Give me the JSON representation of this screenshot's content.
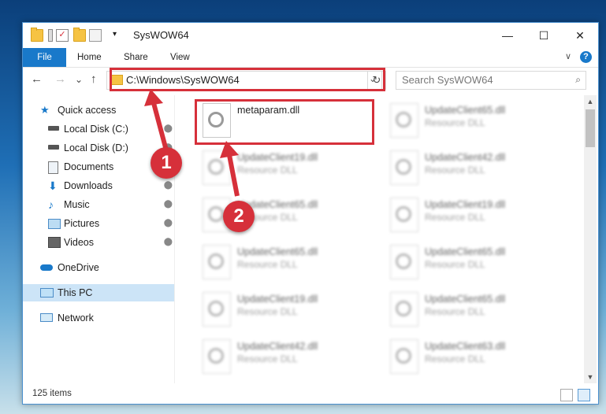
{
  "window": {
    "title": "SysWOW64",
    "minimize": "—",
    "maximize": "☐",
    "close": "✕"
  },
  "ribbon": {
    "tabs": [
      "File",
      "Home",
      "Share",
      "View"
    ],
    "help": "?",
    "collapse": "∨"
  },
  "nav": {
    "back": "←",
    "forward": "→",
    "recent": "⌄",
    "up": "↑",
    "address": "C:\\Windows\\SysWOW64",
    "address_dropdown": "⌄",
    "refresh": "↻",
    "search_placeholder": "Search SysWOW64",
    "search_icon": "⌕"
  },
  "sidebar": {
    "items": [
      {
        "label": "Quick access",
        "icon": "star-icon",
        "pinned": false
      },
      {
        "label": "Local Disk (C:)",
        "icon": "drive-icon",
        "pinned": true
      },
      {
        "label": "Local Disk (D:)",
        "icon": "drive-icon",
        "pinned": true
      },
      {
        "label": "Documents",
        "icon": "documents-icon",
        "pinned": true
      },
      {
        "label": "Downloads",
        "icon": "downloads-icon",
        "pinned": true
      },
      {
        "label": "Music",
        "icon": "music-icon",
        "pinned": true
      },
      {
        "label": "Pictures",
        "icon": "pictures-icon",
        "pinned": true
      },
      {
        "label": "Videos",
        "icon": "videos-icon",
        "pinned": true
      },
      {
        "label": "OneDrive",
        "icon": "cloud-icon",
        "pinned": false
      },
      {
        "label": "This PC",
        "icon": "computer-icon",
        "pinned": false
      },
      {
        "label": "Network",
        "icon": "network-icon",
        "pinned": false
      }
    ],
    "pin_glyph": "📌"
  },
  "files": {
    "highlighted": {
      "name": "metaparam.dll"
    },
    "left_column": [
      {
        "name": "UpdateClient19.dll",
        "type": "Resource DLL"
      },
      {
        "name": "UpdateClient65.dll",
        "type": "Resource DLL"
      },
      {
        "name": "UpdateClient65.dll",
        "type": "Resource DLL"
      },
      {
        "name": "UpdateClient19.dll",
        "type": "Resource DLL"
      },
      {
        "name": "UpdateClient42.dll",
        "type": "Resource DLL"
      }
    ],
    "right_column": [
      {
        "name": "UpdateClient65.dll",
        "type": "Resource DLL"
      },
      {
        "name": "UpdateClient42.dll",
        "type": "Resource DLL"
      },
      {
        "name": "UpdateClient19.dll",
        "type": "Resource DLL"
      },
      {
        "name": "UpdateClient65.dll",
        "type": "Resource DLL"
      },
      {
        "name": "UpdateClient65.dll",
        "type": "Resource DLL"
      },
      {
        "name": "UpdateClient63.dll",
        "type": "Resource DLL"
      }
    ]
  },
  "annotations": {
    "badge1": "1",
    "badge2": "2",
    "highlight_color": "#d6303a"
  },
  "status": {
    "item_count": "125 items"
  }
}
